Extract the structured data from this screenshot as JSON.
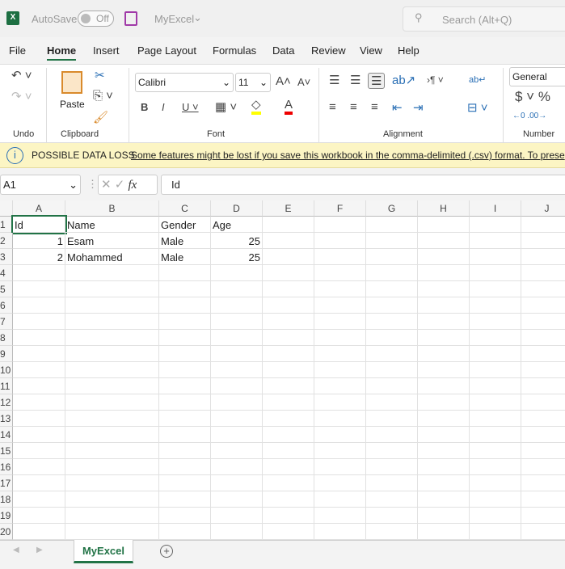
{
  "titlebar": {
    "autosave_label": "AutoSave",
    "autosave_state": "Off",
    "file_name": "MyExcel",
    "search_placeholder": "Search (Alt+Q)"
  },
  "menu": [
    "File",
    "Home",
    "Insert",
    "Page Layout",
    "Formulas",
    "Data",
    "Review",
    "View",
    "Help"
  ],
  "ribbon": {
    "groups": {
      "undo": "Undo",
      "clipboard": "Clipboard",
      "font": "Font",
      "alignment": "Alignment",
      "number": "Number"
    },
    "paste_label": "Paste",
    "font_name": "Calibri",
    "font_size": "11",
    "number_format": "General"
  },
  "banner": {
    "title": "POSSIBLE DATA LOSS",
    "message": "Some features might be lost if you save this workbook in the comma-delimited (.csv) format. To prese"
  },
  "formula_bar": {
    "name_box": "A1",
    "fx": "fx",
    "value": "Id"
  },
  "columns": [
    "A",
    "B",
    "C",
    "D",
    "E",
    "F",
    "G",
    "H",
    "I",
    "J"
  ],
  "rows": [
    "1",
    "2",
    "3",
    "4",
    "5",
    "6",
    "7",
    "8",
    "9",
    "10",
    "11",
    "12",
    "13",
    "14",
    "15",
    "16",
    "17",
    "18",
    "19",
    "20"
  ],
  "cells": [
    [
      "Id",
      "Name",
      "Gender",
      "Age"
    ],
    [
      1,
      "Esam",
      "Male",
      25
    ],
    [
      2,
      "Mohammed",
      "Male",
      25
    ]
  ],
  "sheets": [
    "MyExcel"
  ],
  "colors": {
    "excel_green": "#217346",
    "banner": "#fcf5c4"
  }
}
